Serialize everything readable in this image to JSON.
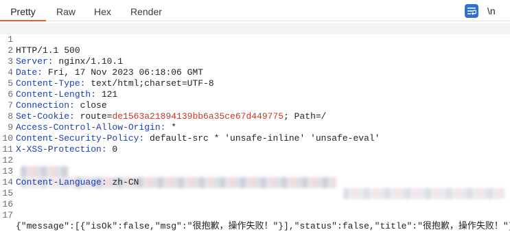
{
  "tabs": [
    "Pretty",
    "Raw",
    "Hex",
    "Render"
  ],
  "active_tab": "Pretty",
  "toolbar": {
    "newline_label": "\\n",
    "wrap_icon": "wrap-lines-icon"
  },
  "accent_color": "#e8602c",
  "lines": [
    {
      "num": "1",
      "text": "HTTP/1.1 500"
    },
    {
      "num": "2",
      "key": "Server:",
      "value": " nginx/1.10.1"
    },
    {
      "num": "3",
      "key": "Date:",
      "value": " Fri, 17 Nov 2023 06:18:06 GMT"
    },
    {
      "num": "4",
      "key": "Content-Type:",
      "value": " text/html;charset=UTF-8"
    },
    {
      "num": "5",
      "key": "Content-Length:",
      "value": " 121"
    },
    {
      "num": "6",
      "key": "Connection:",
      "value": " close"
    },
    {
      "num": "7",
      "key": "Set-Cookie:",
      "value_a": " route=",
      "value_b": "de1563a21894139bb6a35ce67d449775",
      "value_c": "; Path=/"
    },
    {
      "num": "8",
      "key": "Access-Control-Allow-Origin:",
      "value": " *"
    },
    {
      "num": "9",
      "key": "Content-Security-Policy:",
      "value": " default-src * 'unsafe-inline' 'unsafe-eval'"
    },
    {
      "num": "10",
      "key": "X-XSS-Protection:",
      "value": " 0"
    },
    {
      "num": "11",
      "text": ""
    },
    {
      "num": "12",
      "text": ""
    },
    {
      "num": "13",
      "key": "Content-Language:",
      "value": " zh-CN"
    },
    {
      "num": "14",
      "text": ""
    },
    {
      "num": "15",
      "text": ""
    },
    {
      "num": "16",
      "text": ""
    },
    {
      "num": "17",
      "text": "{\"message\":[{\"isOk\":false,\"msg\":\"很抱歉，操作失败！\"}],\"status\":false,\"title\":\"很抱歉，操作失败！\"}"
    }
  ]
}
